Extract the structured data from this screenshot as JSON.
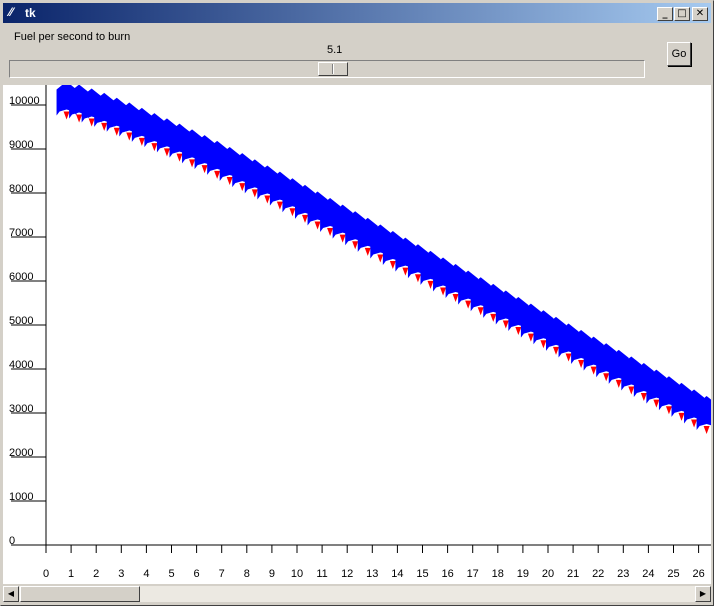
{
  "window": {
    "title": "tk",
    "app_icon": "tk-feather-icon",
    "minimize_glyph": "_",
    "maximize_glyph": "□",
    "close_glyph": "✕"
  },
  "controls": {
    "fuel_label": "Fuel per second to burn",
    "scale_value": "5.1",
    "scale_position_fraction": 0.51,
    "go_label": "Go"
  },
  "scrollbar": {
    "left_arrow": "◀",
    "right_arrow": "▶",
    "thumb_fraction": 0.0
  },
  "chart_data": {
    "type": "scatter",
    "title": "",
    "xlabel": "",
    "ylabel": "",
    "xlim": [
      0,
      26
    ],
    "ylim": [
      0,
      10000
    ],
    "x_ticks": [
      0,
      1,
      2,
      3,
      4,
      5,
      6,
      7,
      8,
      9,
      10,
      11,
      12,
      13,
      14,
      15,
      16,
      17,
      18,
      19,
      20,
      21,
      22,
      23,
      24,
      25,
      26
    ],
    "y_ticks": [
      0,
      1000,
      2000,
      3000,
      4000,
      5000,
      6000,
      7000,
      8000,
      9000,
      10000
    ],
    "rocket_color": "#0000ff",
    "flame_color": "#ff0000",
    "series": [
      {
        "x": [
          0.5,
          1.0,
          1.5,
          2.0,
          2.5,
          3.0,
          3.5,
          4.0,
          4.5,
          5.0,
          5.5,
          6.0,
          6.5,
          7.0,
          7.5,
          8.0,
          8.5,
          9.0,
          9.5,
          10.0,
          10.5,
          11.0,
          11.5,
          12.0,
          12.5,
          13.0,
          13.5,
          14.0,
          14.5,
          15.0,
          15.5,
          16.0,
          16.5,
          17.0,
          17.5,
          18.0,
          18.5,
          19.0,
          19.5,
          20.0,
          20.5,
          21.0,
          21.5,
          22.0,
          22.5,
          23.0,
          23.5,
          24.0,
          24.5,
          25.0,
          25.5,
          26.0
        ],
        "y": [
          9990,
          9920,
          9830,
          9730,
          9620,
          9510,
          9390,
          9270,
          9150,
          9030,
          8900,
          8770,
          8640,
          8500,
          8360,
          8220,
          8080,
          7940,
          7790,
          7640,
          7490,
          7340,
          7190,
          7040,
          6890,
          6740,
          6590,
          6440,
          6290,
          6140,
          5990,
          5840,
          5690,
          5540,
          5390,
          5240,
          5090,
          4940,
          4790,
          4640,
          4490,
          4340,
          4190,
          4040,
          3890,
          3740,
          3590,
          3440,
          3290,
          3140,
          2990,
          2840
        ]
      }
    ]
  }
}
